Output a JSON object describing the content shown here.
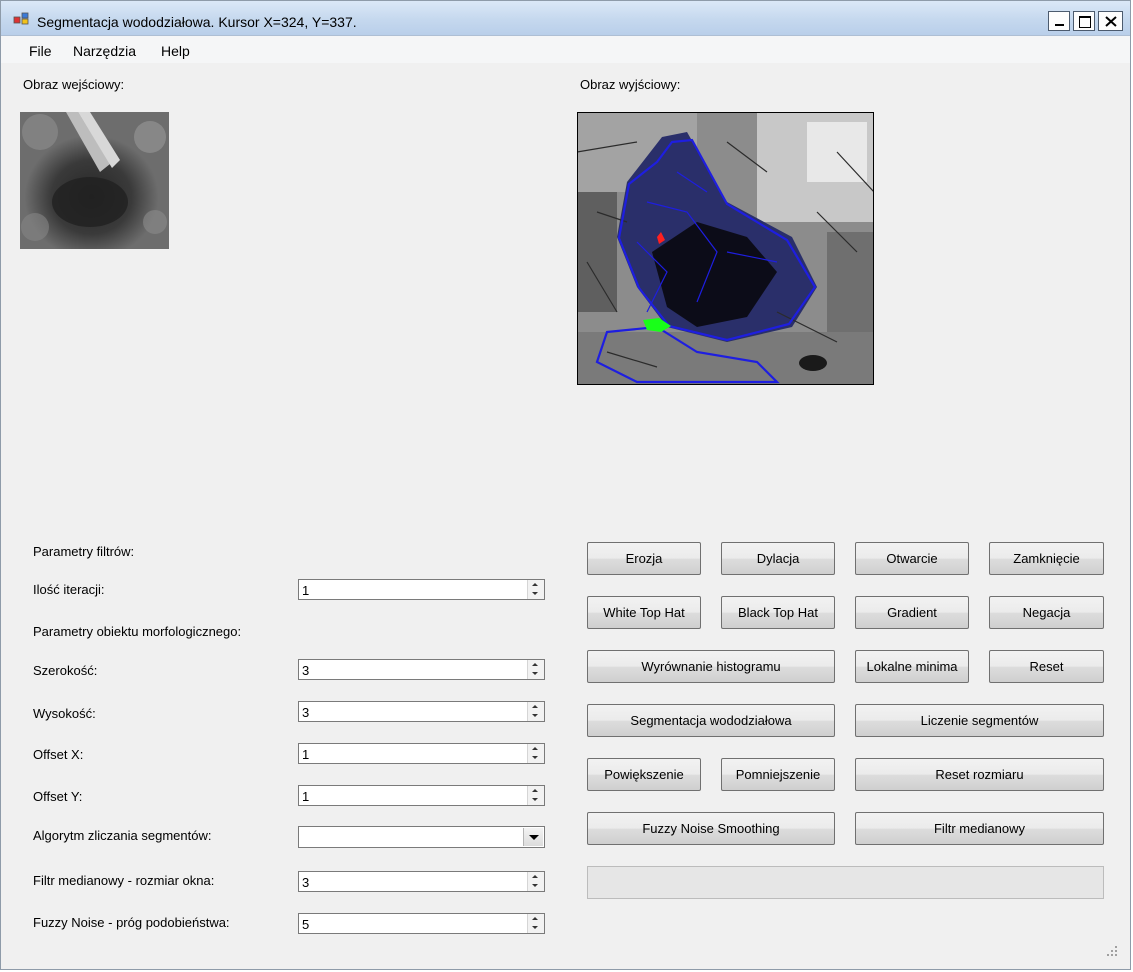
{
  "window": {
    "title": "Segmentacja wododziałowa. Kursor X=324, Y=337.",
    "minimize_glyph": "_",
    "close_glyph": "✕"
  },
  "menu": [
    {
      "label": "File"
    },
    {
      "label": "Narzędzia"
    },
    {
      "label": "Help"
    }
  ],
  "input_image": {
    "label": "Obraz wejściowy:"
  },
  "output_image": {
    "label": "Obraz wyjściowy:",
    "segment_outline_color": "#1e1ee0",
    "marker_colors": [
      "#ff2020",
      "#19ff19"
    ]
  },
  "params": {
    "filters_heading": "Parametry filtrów:",
    "morph_heading": "Parametry obiektu morfologicznego:",
    "iterations": {
      "label": "Ilość iteracji:",
      "value": "1"
    },
    "width": {
      "label": "Szerokość:",
      "value": "3"
    },
    "height": {
      "label": "Wysokość:",
      "value": "3"
    },
    "offset_x": {
      "label": "Offset X:",
      "value": "1"
    },
    "offset_y": {
      "label": "Offset Y:",
      "value": "1"
    },
    "segment_algorithm": {
      "label": "Algorytm zliczania segmentów:",
      "value": ""
    },
    "median_window": {
      "label": "Filtr medianowy - rozmiar okna:",
      "value": "3"
    },
    "fuzzy_threshold": {
      "label": "Fuzzy Noise  - próg podobieństwa:",
      "value": "5"
    }
  },
  "buttons": {
    "erosion": "Erozja",
    "dilation": "Dylacja",
    "opening": "Otwarcie",
    "closing": "Zamknięcie",
    "white_top_hat": "White Top Hat",
    "black_top_hat": "Black Top Hat",
    "gradient": "Gradient",
    "negation": "Negacja",
    "histogram_eq": "Wyrównanie histogramu",
    "local_minima": "Lokalne minima",
    "reset": "Reset",
    "watershed": "Segmentacja wododziałowa",
    "count_segments": "Liczenie segmentów",
    "zoom_in": "Powiększenie",
    "zoom_out": "Pomniejszenie",
    "reset_size": "Reset rozmiaru",
    "fuzzy_noise": "Fuzzy Noise Smoothing",
    "median_filter": "Filtr medianowy"
  },
  "progress": {
    "value": 0
  }
}
